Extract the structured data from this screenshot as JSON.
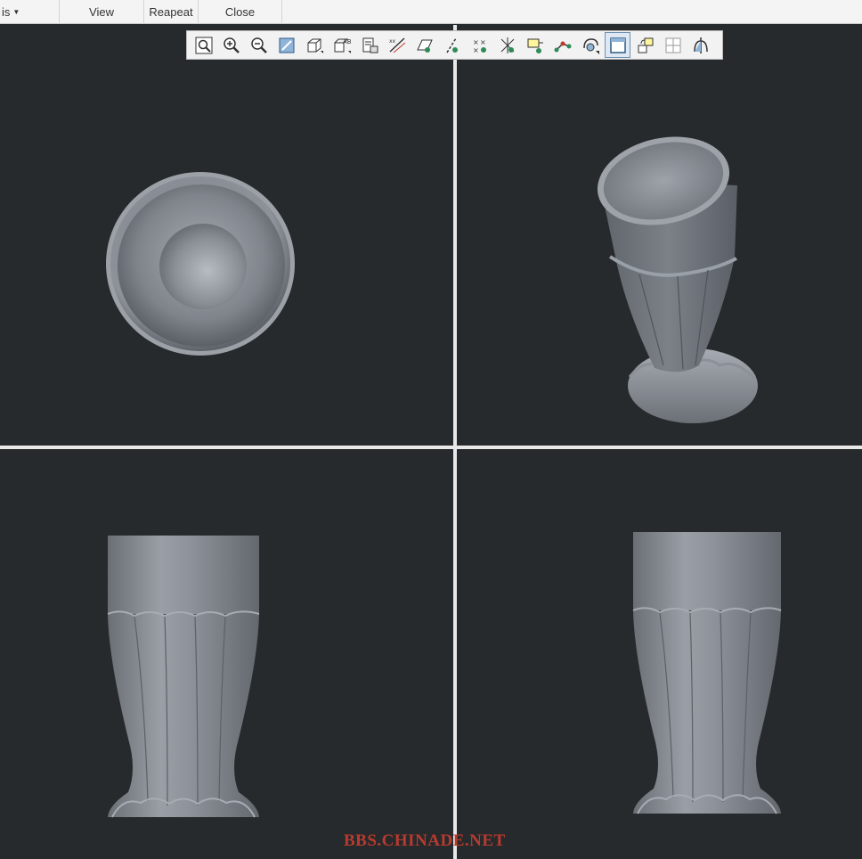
{
  "menubar": {
    "items": [
      {
        "label": "is",
        "has_caret": true
      },
      {
        "label": "View"
      },
      {
        "label": "Reapeat"
      },
      {
        "label": "Close"
      }
    ]
  },
  "toolbar": {
    "icons": [
      {
        "name": "refit-icon"
      },
      {
        "name": "zoom-in-icon"
      },
      {
        "name": "zoom-out-icon"
      },
      {
        "name": "repaint-icon"
      },
      {
        "name": "display-style-icon"
      },
      {
        "name": "named-views-icon"
      },
      {
        "name": "layers-icon"
      },
      {
        "name": "datum-planes-icon"
      },
      {
        "name": "plane-display-icon"
      },
      {
        "name": "axis-display-icon"
      },
      {
        "name": "point-display-icon"
      },
      {
        "name": "csys-display-icon"
      },
      {
        "name": "annotation-display-icon"
      },
      {
        "name": "spin-center-icon"
      },
      {
        "name": "orient-mode-icon"
      },
      {
        "name": "single-view-icon",
        "active": true
      },
      {
        "name": "rotate-view-icon"
      },
      {
        "name": "multi-view-icon"
      },
      {
        "name": "section-view-icon"
      }
    ]
  },
  "watermark": {
    "text": "BBS.CHINADE.NET"
  },
  "colors": {
    "viewport_bg": "#272a2c",
    "model_gray": "#8a8f96",
    "divider": "#e8e8e8",
    "watermark": "#b83a2e"
  }
}
